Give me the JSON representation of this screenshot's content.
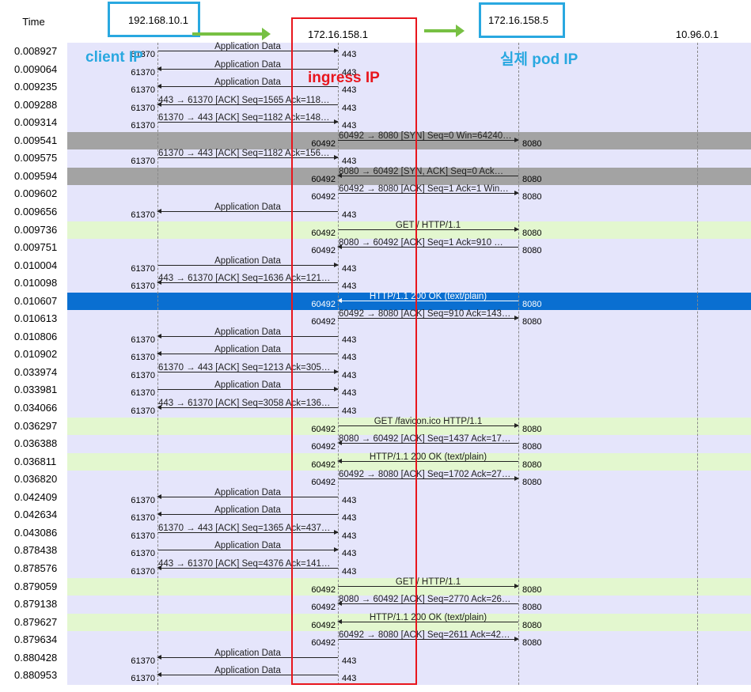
{
  "header": {
    "time_label": "Time"
  },
  "hosts": [
    "192.168.10.1",
    "172.16.158.1",
    "172.16.158.5",
    "10.96.0.1"
  ],
  "annotations": {
    "client": "client IP",
    "ingress": "ingress IP",
    "pod": "실제 pod IP"
  },
  "colors": {
    "graph_bg": "#e5e5fb",
    "selected_row": "#0a6fd1",
    "syn_row": "#a3a3a3",
    "http_row": "#e3f7cf",
    "client_box": "#29a8e0",
    "ingress_box": "#e8161d",
    "flow_arrow": "#77c043"
  },
  "rows": [
    {
      "time": "0.008927",
      "from": 0,
      "to": 1,
      "label": "Application Data",
      "src_port": "61370",
      "dst_port": "443",
      "style": "normal"
    },
    {
      "time": "0.009064",
      "from": 1,
      "to": 0,
      "label": "Application Data",
      "src_port": "443",
      "dst_port": "61370",
      "style": "normal"
    },
    {
      "time": "0.009235",
      "from": 1,
      "to": 0,
      "label": "Application Data",
      "src_port": "443",
      "dst_port": "61370",
      "style": "normal"
    },
    {
      "time": "0.009288",
      "from": 1,
      "to": 0,
      "label": "443 → 61370 [ACK] Seq=1565 Ack=118…",
      "src_port": "443",
      "dst_port": "61370",
      "style": "normal"
    },
    {
      "time": "0.009314",
      "from": 0,
      "to": 1,
      "label": "61370 → 443 [ACK] Seq=1182 Ack=148…",
      "src_port": "61370",
      "dst_port": "443",
      "style": "normal"
    },
    {
      "time": "0.009541",
      "from": 1,
      "to": 2,
      "label": "60492 → 8080 [SYN] Seq=0 Win=64240…",
      "src_port": "60492",
      "dst_port": "8080",
      "style": "syn"
    },
    {
      "time": "0.009575",
      "from": 0,
      "to": 1,
      "label": "61370 → 443 [ACK] Seq=1182 Ack=156…",
      "src_port": "61370",
      "dst_port": "443",
      "style": "normal"
    },
    {
      "time": "0.009594",
      "from": 2,
      "to": 1,
      "label": "8080 → 60492 [SYN, ACK] Seq=0 Ack…",
      "src_port": "8080",
      "dst_port": "60492",
      "style": "syn"
    },
    {
      "time": "0.009602",
      "from": 1,
      "to": 2,
      "label": "60492 → 8080 [ACK] Seq=1 Ack=1 Win…",
      "src_port": "60492",
      "dst_port": "8080",
      "style": "normal"
    },
    {
      "time": "0.009656",
      "from": 1,
      "to": 0,
      "label": "Application Data",
      "src_port": "443",
      "dst_port": "61370",
      "style": "normal"
    },
    {
      "time": "0.009736",
      "from": 1,
      "to": 2,
      "label": "GET / HTTP/1.1",
      "src_port": "60492",
      "dst_port": "8080",
      "style": "http"
    },
    {
      "time": "0.009751",
      "from": 2,
      "to": 1,
      "label": "8080 → 60492 [ACK] Seq=1 Ack=910 …",
      "src_port": "8080",
      "dst_port": "60492",
      "style": "normal"
    },
    {
      "time": "0.010004",
      "from": 0,
      "to": 1,
      "label": "Application Data",
      "src_port": "61370",
      "dst_port": "443",
      "style": "normal"
    },
    {
      "time": "0.010098",
      "from": 1,
      "to": 0,
      "label": "443 → 61370 [ACK] Seq=1636 Ack=121…",
      "src_port": "443",
      "dst_port": "61370",
      "style": "normal"
    },
    {
      "time": "0.010607",
      "from": 2,
      "to": 1,
      "label": "HTTP/1.1 200 OK  (text/plain)",
      "src_port": "8080",
      "dst_port": "60492",
      "style": "selected"
    },
    {
      "time": "0.010613",
      "from": 1,
      "to": 2,
      "label": "60492 → 8080 [ACK] Seq=910 Ack=143…",
      "src_port": "60492",
      "dst_port": "8080",
      "style": "normal"
    },
    {
      "time": "0.010806",
      "from": 1,
      "to": 0,
      "label": "Application Data",
      "src_port": "443",
      "dst_port": "61370",
      "style": "normal"
    },
    {
      "time": "0.010902",
      "from": 1,
      "to": 0,
      "label": "Application Data",
      "src_port": "443",
      "dst_port": "61370",
      "style": "normal"
    },
    {
      "time": "0.033974",
      "from": 0,
      "to": 1,
      "label": "61370 → 443 [ACK] Seq=1213 Ack=305…",
      "src_port": "61370",
      "dst_port": "443",
      "style": "normal"
    },
    {
      "time": "0.033981",
      "from": 0,
      "to": 1,
      "label": "Application Data",
      "src_port": "61370",
      "dst_port": "443",
      "style": "normal"
    },
    {
      "time": "0.034066",
      "from": 1,
      "to": 0,
      "label": "443 → 61370 [ACK] Seq=3058 Ack=136…",
      "src_port": "443",
      "dst_port": "61370",
      "style": "normal"
    },
    {
      "time": "0.036297",
      "from": 1,
      "to": 2,
      "label": "GET /favicon.ico HTTP/1.1",
      "src_port": "60492",
      "dst_port": "8080",
      "style": "http"
    },
    {
      "time": "0.036388",
      "from": 2,
      "to": 1,
      "label": "8080 → 60492 [ACK] Seq=1437 Ack=17…",
      "src_port": "8080",
      "dst_port": "60492",
      "style": "normal"
    },
    {
      "time": "0.036811",
      "from": 2,
      "to": 1,
      "label": "HTTP/1.1 200 OK  (text/plain)",
      "src_port": "8080",
      "dst_port": "60492",
      "style": "http"
    },
    {
      "time": "0.036820",
      "from": 1,
      "to": 2,
      "label": "60492 → 8080 [ACK] Seq=1702 Ack=27…",
      "src_port": "60492",
      "dst_port": "8080",
      "style": "normal"
    },
    {
      "time": "0.042409",
      "from": 1,
      "to": 0,
      "label": "Application Data",
      "src_port": "443",
      "dst_port": "61370",
      "style": "normal"
    },
    {
      "time": "0.042634",
      "from": 1,
      "to": 0,
      "label": "Application Data",
      "src_port": "443",
      "dst_port": "61370",
      "style": "normal"
    },
    {
      "time": "0.043086",
      "from": 0,
      "to": 1,
      "label": "61370 → 443 [ACK] Seq=1365 Ack=437…",
      "src_port": "61370",
      "dst_port": "443",
      "style": "normal"
    },
    {
      "time": "0.878438",
      "from": 0,
      "to": 1,
      "label": "Application Data",
      "src_port": "61370",
      "dst_port": "443",
      "style": "normal"
    },
    {
      "time": "0.878576",
      "from": 1,
      "to": 0,
      "label": "443 → 61370 [ACK] Seq=4376 Ack=141…",
      "src_port": "443",
      "dst_port": "61370",
      "style": "normal"
    },
    {
      "time": "0.879059",
      "from": 1,
      "to": 2,
      "label": "GET / HTTP/1.1",
      "src_port": "60492",
      "dst_port": "8080",
      "style": "http"
    },
    {
      "time": "0.879138",
      "from": 2,
      "to": 1,
      "label": "8080 → 60492 [ACK] Seq=2770 Ack=26…",
      "src_port": "8080",
      "dst_port": "60492",
      "style": "normal"
    },
    {
      "time": "0.879627",
      "from": 2,
      "to": 1,
      "label": "HTTP/1.1 200 OK  (text/plain)",
      "src_port": "8080",
      "dst_port": "60492",
      "style": "http"
    },
    {
      "time": "0.879634",
      "from": 1,
      "to": 2,
      "label": "60492 → 8080 [ACK] Seq=2611 Ack=42…",
      "src_port": "60492",
      "dst_port": "8080",
      "style": "normal"
    },
    {
      "time": "0.880428",
      "from": 1,
      "to": 0,
      "label": "Application Data",
      "src_port": "443",
      "dst_port": "61370",
      "style": "normal"
    },
    {
      "time": "0.880953",
      "from": 1,
      "to": 0,
      "label": "Application Data",
      "src_port": "443",
      "dst_port": "61370",
      "style": "normal"
    }
  ]
}
